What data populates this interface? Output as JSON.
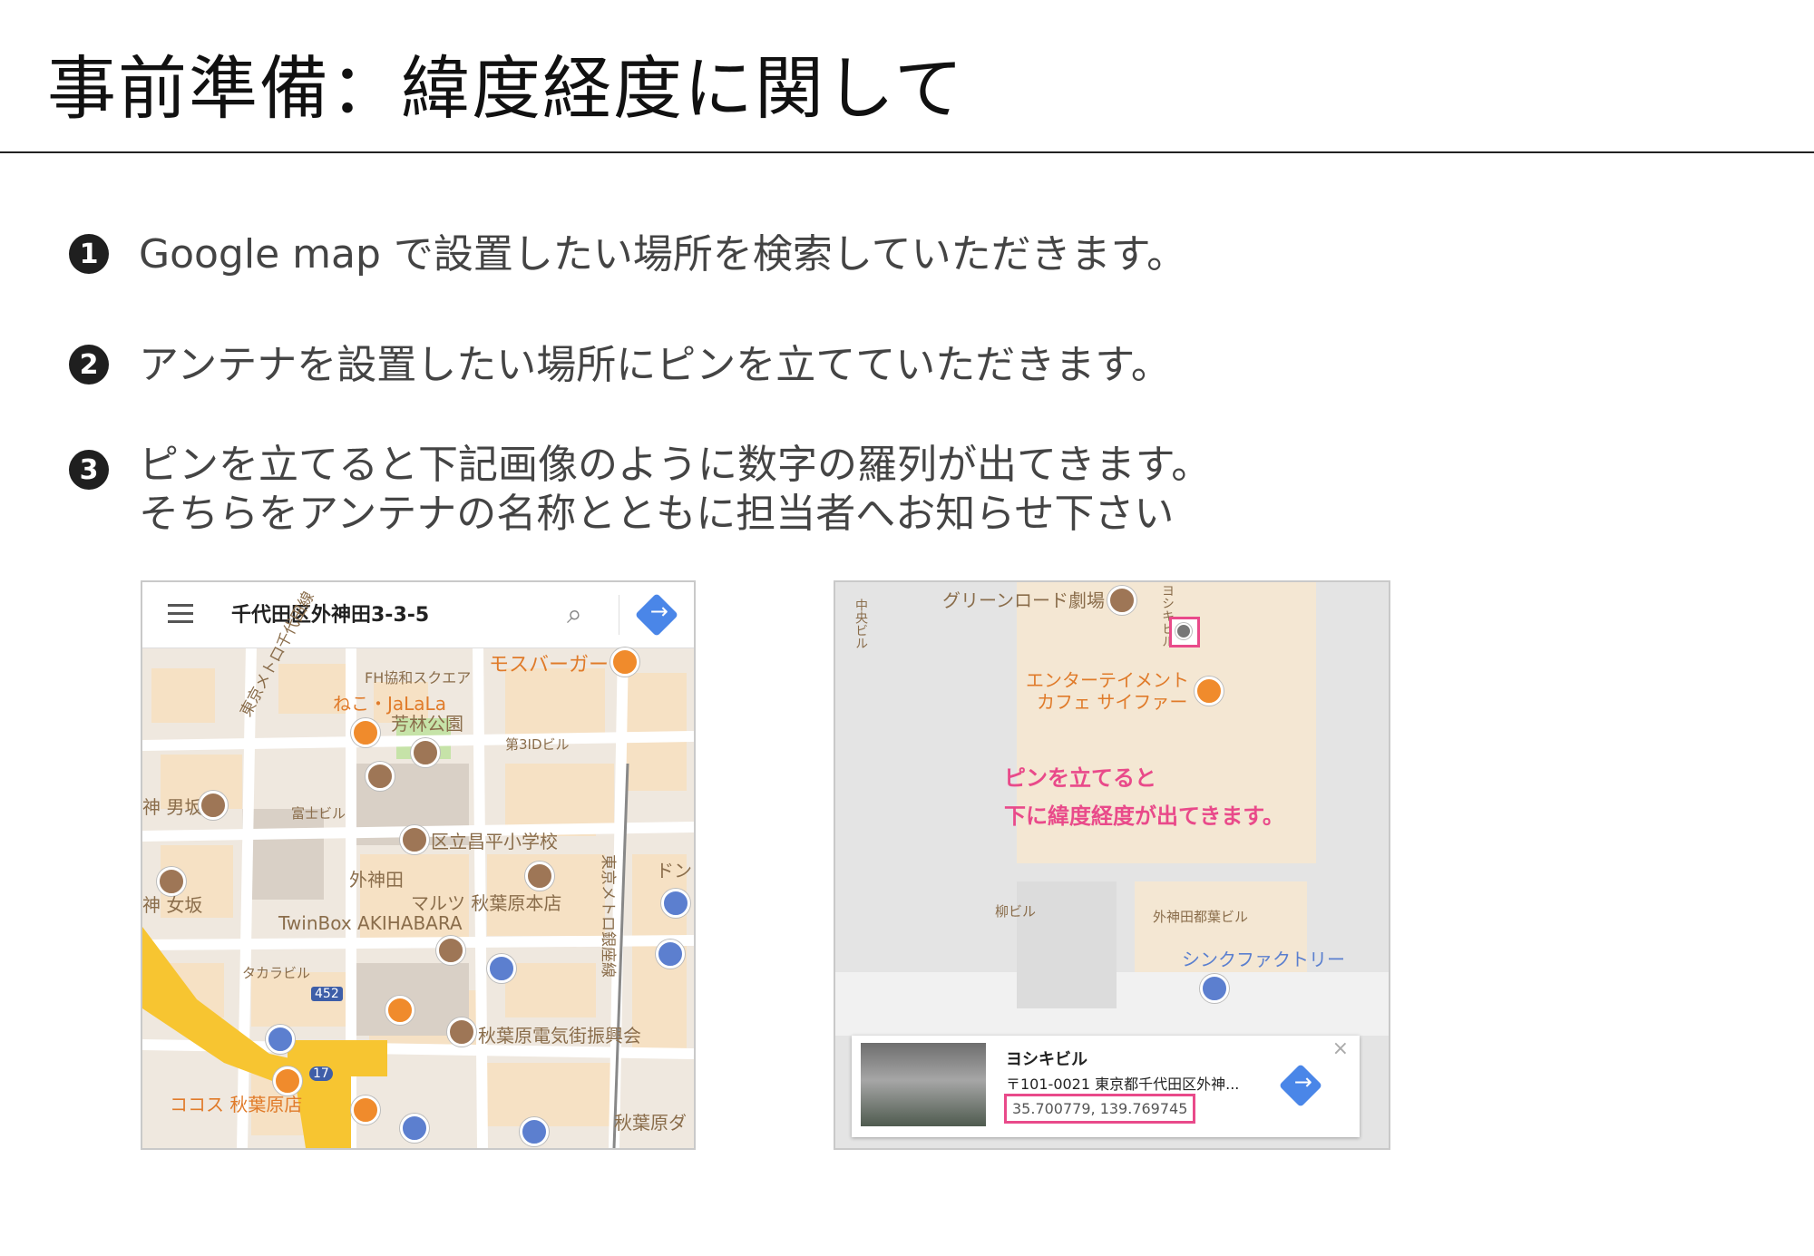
{
  "title": "事前準備：緯度経度に関して",
  "steps": [
    {
      "number": "1",
      "lines": [
        "Google map で設置したい場所を検索していただきます。"
      ]
    },
    {
      "number": "2",
      "lines": [
        "アンテナを設置したい場所にピンを立てていただきます。"
      ]
    },
    {
      "number": "3",
      "lines": [
        "ピンを立てると下記画像のように数字の羅列が出てきます。",
        "そちらをアンテナの名称とともに担当者へお知らせ下さい"
      ]
    }
  ],
  "map1": {
    "address": "千代田区外神田3-3-5",
    "labels": {
      "mos": "モスバーガー",
      "fh": "FH協和スクエア",
      "neko": "ねこ・JaLaLa",
      "park": "芳林公園",
      "bldg3id": "第3IDビル",
      "metro": "東京メトロ千代田線",
      "otokozaka": "神 男坂",
      "fuji": "富士ビル",
      "school": "区立昌平小学校",
      "sotokanda": "外神田",
      "maruetsu": "マルツ 秋葉原本店",
      "onnazaka": "神 女坂",
      "twinbox": "TwinBox AKIHABARA",
      "takara": "タカラビル",
      "route452": "452",
      "denki": "秋葉原電気街振興会",
      "route17": "17",
      "cocos": "ココス 秋葉原店",
      "akihabara": "秋葉原ダ",
      "ginza": "東京メトロ銀座線",
      "don": "ドン"
    }
  },
  "map2": {
    "labels": {
      "greenroad": "グリーンロード劇場",
      "yoshiki_vertical": "ヨシキビル",
      "chuo": "中央ビル",
      "entertain1": "エンターテイメント",
      "entertain2": "カフェ サイファー",
      "note1": "ピンを立てると",
      "note2": "下に緯度経度が出てきます。",
      "yanagi": "柳ビル",
      "sotokanda_toba": "外神田都葉ビル",
      "syncfactory": "シンクファクトリー"
    },
    "card": {
      "name": "ヨシキビル",
      "address": "〒101-0021 東京都千代田区外神...",
      "coords": "35.700779, 139.769745",
      "close": "×"
    }
  },
  "colors": {
    "accent_pink": "#e94a8a",
    "poi_orange": "#f08b2c",
    "road_yellow": "#f7c531"
  }
}
